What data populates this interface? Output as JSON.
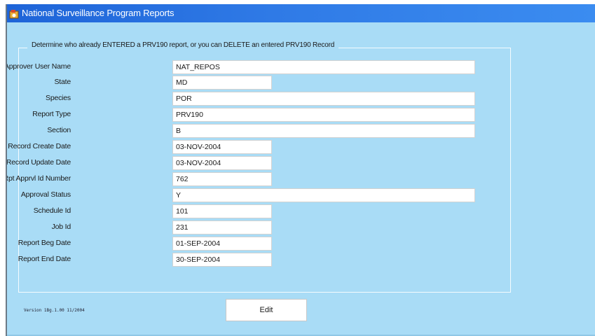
{
  "window": {
    "title": "National Surveillance Program Reports",
    "icon": "oracle-forms-icon"
  },
  "form": {
    "legend": "Determine who already ENTERED a PRV190 report, or you can DELETE an entered PRV190 Record",
    "fields": [
      {
        "label": "Approver User Name",
        "value": "NAT_REPOS"
      },
      {
        "label": "State",
        "value": "MD"
      },
      {
        "label": "Species",
        "value": "POR"
      },
      {
        "label": "Report Type",
        "value": "PRV190"
      },
      {
        "label": "Section",
        "value": "B"
      },
      {
        "label": "Record Create Date",
        "value": "03-NOV-2004"
      },
      {
        "label": "Record Update Date",
        "value": "03-NOV-2004"
      },
      {
        "label": "Mon Rpt Apprvl Id Number",
        "value": "762"
      },
      {
        "label": "Approval Status",
        "value": "Y"
      },
      {
        "label": "Schedule Id",
        "value": "101"
      },
      {
        "label": "Job Id",
        "value": "231"
      },
      {
        "label": "Report Beg Date",
        "value": "01-SEP-2004"
      },
      {
        "label": "Report End Date",
        "value": "30-SEP-2004"
      }
    ]
  },
  "footer": {
    "version": "Version 1Bg.1.00 11/2004",
    "edit_label": "Edit"
  },
  "colors": {
    "background": "#a9dcf6",
    "titlebar": "#2f7ae6"
  }
}
